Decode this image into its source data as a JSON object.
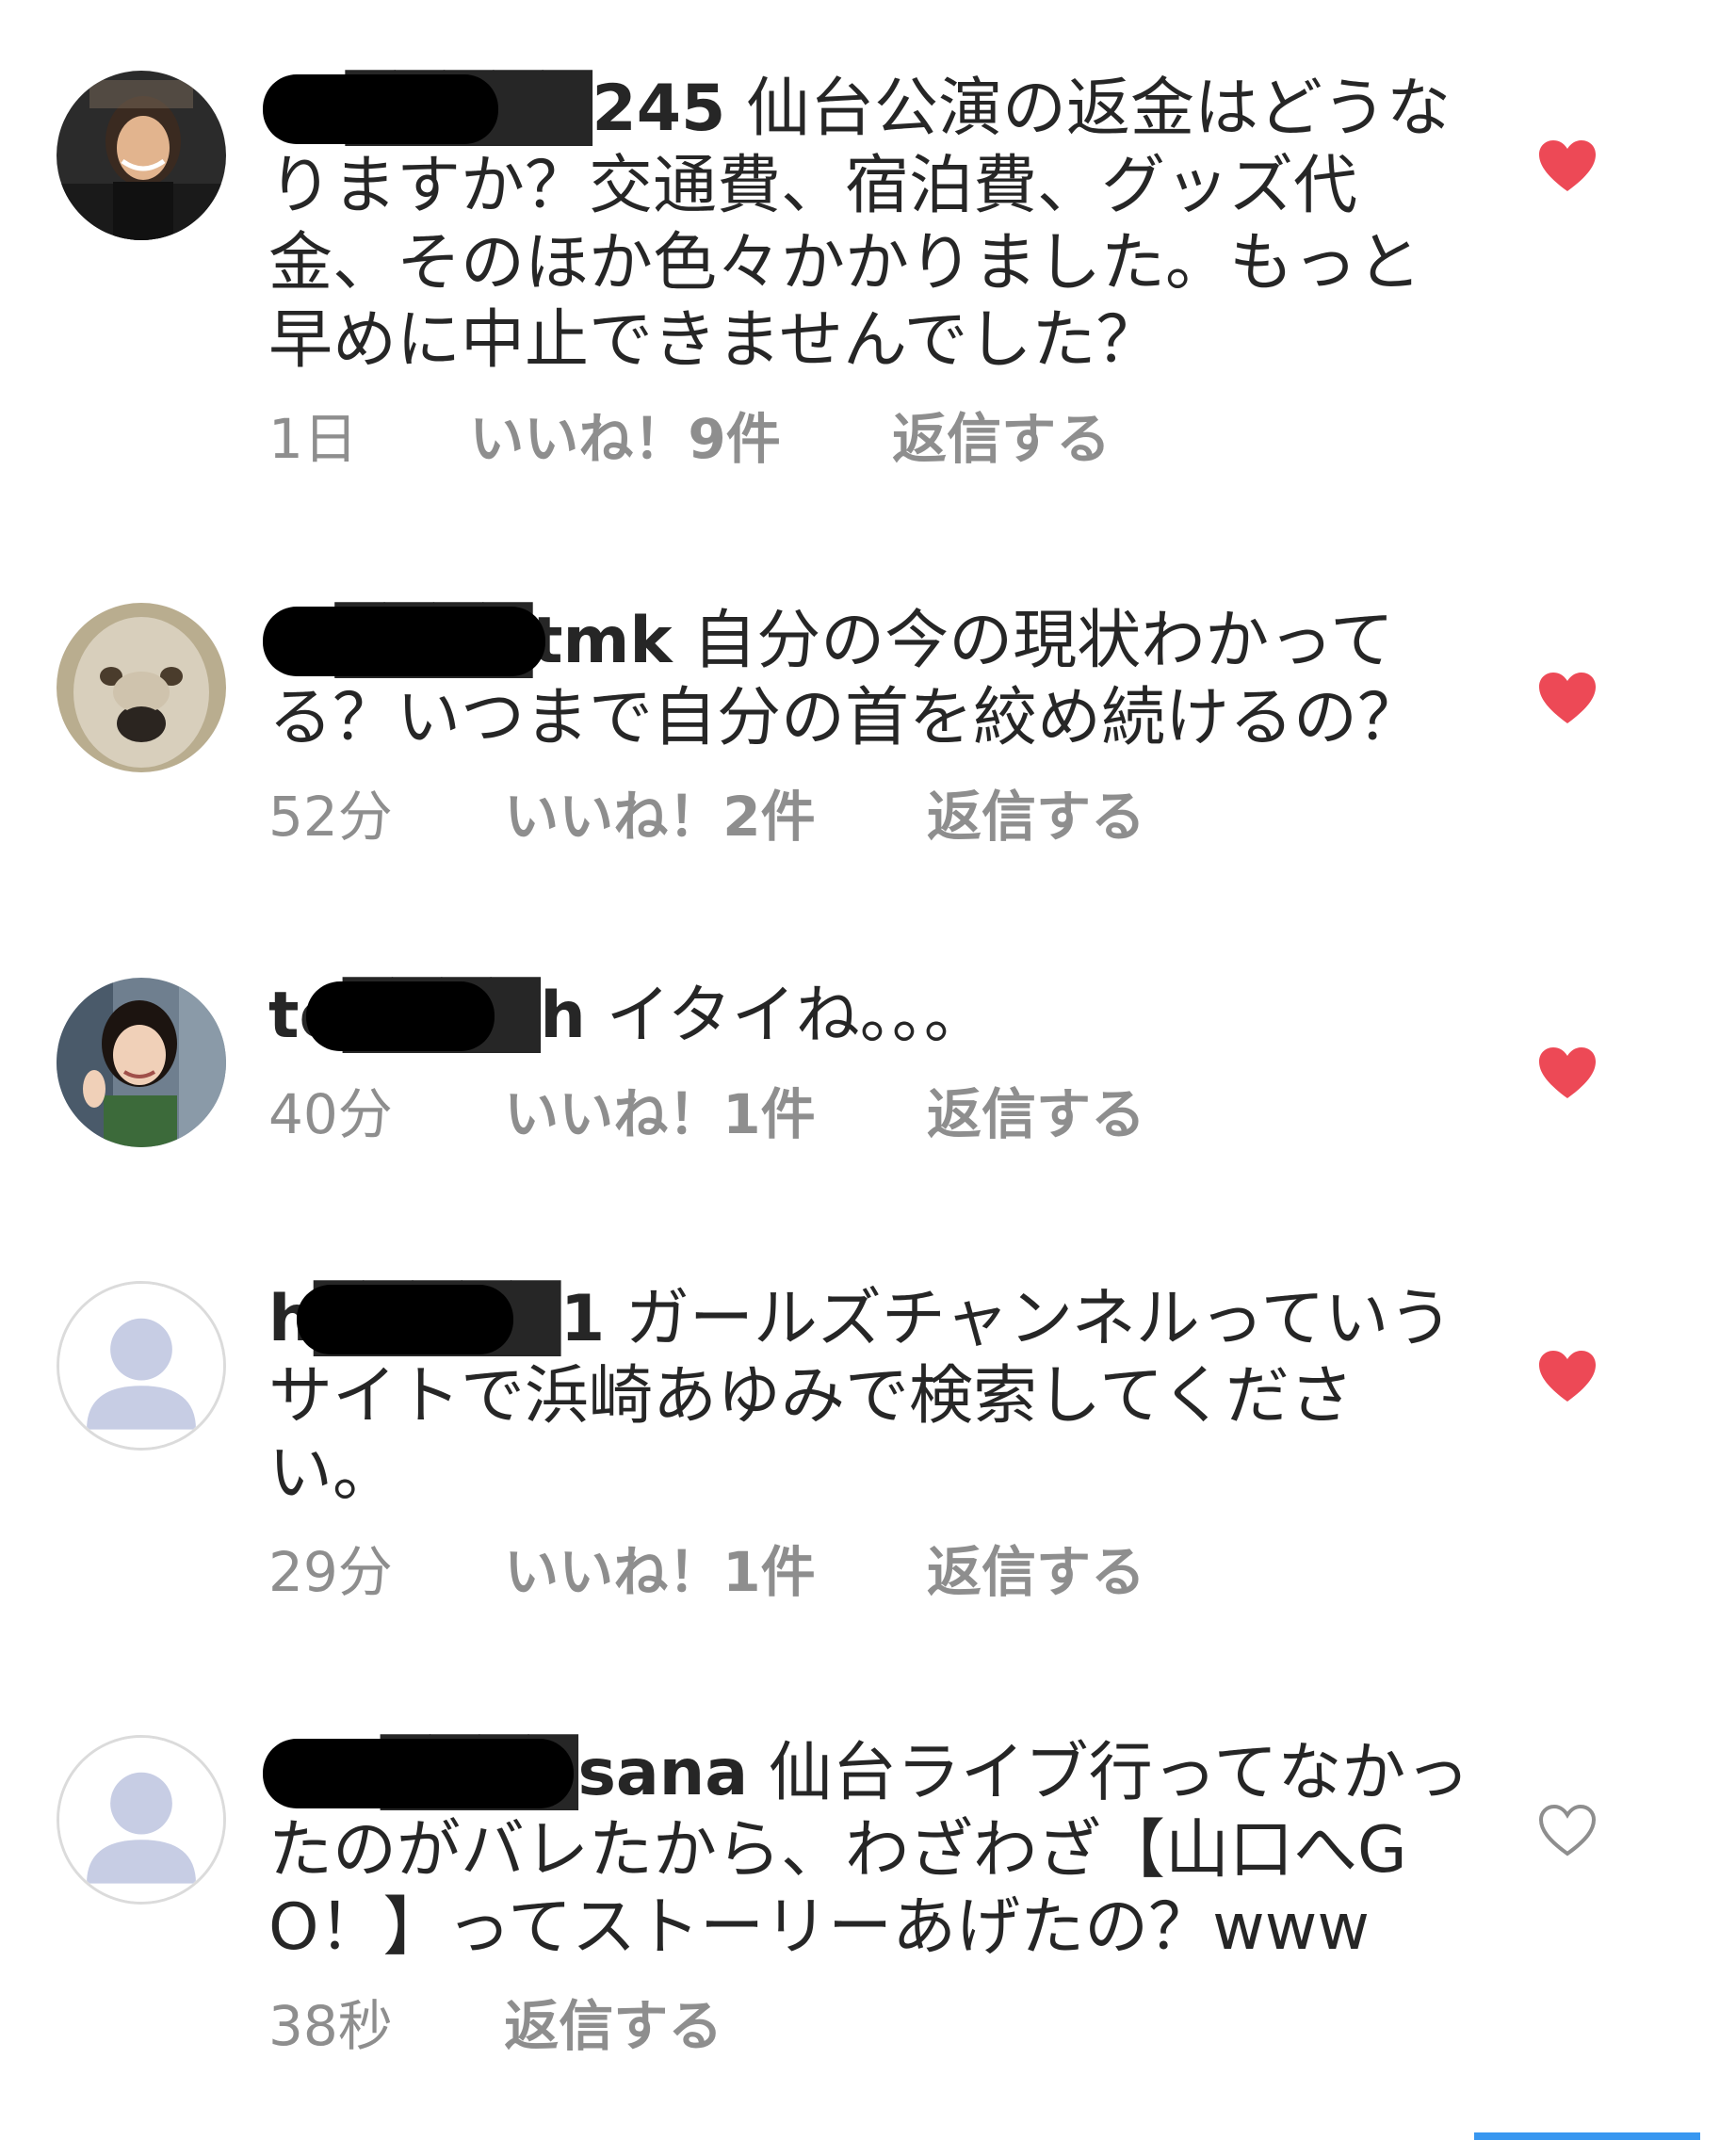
{
  "colors": {
    "heart_filled": "#ed4956",
    "heart_outline": "#8e8e8e",
    "meta_text": "#8e8e8e",
    "body_text": "#262626"
  },
  "comments": [
    {
      "username": "ru█████245",
      "text": "仙台公演の返金はどうなりますか？交通費、宿泊費、グッズ代金、そのほか色々かかりました。もっと早めに中止できませんでした？",
      "time": "1日",
      "likes": "いいね！9件",
      "reply": "返信する",
      "liked": true,
      "avatar_icon": "woman-singer-avatar-icon"
    },
    {
      "username": "m████tmk",
      "text": "自分の今の現状わかってる？いつまで自分の首を絞め続けるの？",
      "time": "52分",
      "likes": "いいね！2件",
      "reply": "返信する",
      "liked": true,
      "avatar_icon": "dog-avatar-icon"
    },
    {
      "username": "to████h",
      "text": "イタイね。。。",
      "time": "40分",
      "likes": "いいね！1件",
      "reply": "返信する",
      "liked": true,
      "avatar_icon": "girl-avatar-icon"
    },
    {
      "username": "h█████1",
      "text": "ガールズチャンネルっていうサイトで浜崎あゆみで検索してください。",
      "time": "29分",
      "likes": "いいね！1件",
      "reply": "返信する",
      "liked": true,
      "avatar_icon": "default-user-avatar-icon"
    },
    {
      "username": "mu████sana",
      "text": "仙台ライブ行ってなかったのがバレたから、わざわざ【山口へGO！】ってストーリーあげたの？www",
      "time": "38秒",
      "likes": "",
      "reply": "返信する",
      "liked": false,
      "avatar_icon": "default-user-avatar-icon"
    }
  ]
}
